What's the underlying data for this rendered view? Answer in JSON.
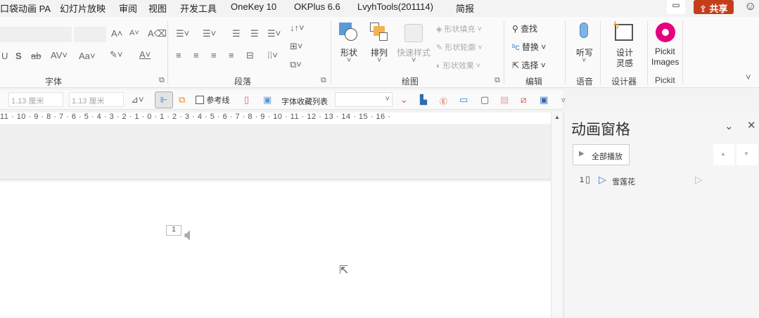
{
  "menu": {
    "items": [
      "口袋动画 PA",
      "幻灯片放映",
      "审阅",
      "视图",
      "开发工具",
      "OneKey 10",
      "OKPlus 6.6",
      "LvyhTools(201114)",
      "简报"
    ],
    "share_label": "共享"
  },
  "ribbon": {
    "font_group": {
      "label": "字体"
    },
    "paragraph_group": {
      "label": "段落"
    },
    "drawing_group": {
      "label": "绘图",
      "shape": "形状",
      "arrange": "排列",
      "quick_styles": "快速样式",
      "shape_fill": "形状填充",
      "shape_outline": "形状轮廓",
      "shape_effects": "形状效果"
    },
    "editing_group": {
      "label": "编辑",
      "find": "查找",
      "replace": "替换",
      "select": "选择"
    },
    "voice_group": {
      "label": "语音",
      "dictate": "听写"
    },
    "designer_group": {
      "label": "设计器",
      "design_ideas_1": "设计",
      "design_ideas_2": "灵感"
    },
    "pickit_group": {
      "label": "Pickit",
      "btn1": "Pickit",
      "btn2": "Images"
    }
  },
  "quickbar": {
    "height_value": "1.13 厘米",
    "width_value": "1.13 厘米",
    "guides_label": "参考线",
    "font_fav_label": "字体收藏列表",
    "font_fav_value": ""
  },
  "ruler": {
    "text": "11 · 10 · 9 · 8 · 7 · 6 · 5 · 4 · 3 · 2 · 1 · 0 · 1 · 2 · 3 · 4 · 5 · 6 · 7 · 8 · 9 · 10 · 11 · 12 · 13 · 14 · 15 · 16 ·"
  },
  "slide": {
    "anim_tag": "1"
  },
  "pane": {
    "title": "动画窗格",
    "play_all": "全部播放",
    "items": [
      {
        "index": "1",
        "name": "雪莲花"
      }
    ]
  },
  "colors": {
    "share": "#c43e1c",
    "accent": "#2b7cd3",
    "pickit": "#e6007e"
  }
}
